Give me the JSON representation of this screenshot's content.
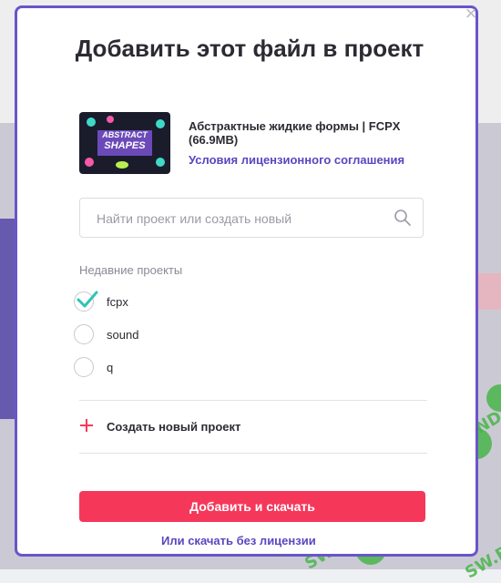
{
  "modal": {
    "title": "Добавить этот файл в проект",
    "file": {
      "thumbnail_text_line1": "ABSTRACT",
      "thumbnail_text_line2": "SHAPES",
      "name": "Абстрактные жидкие формы | FCPX (66.9MB)",
      "license_link": "Условия лицензионного соглашения"
    },
    "search": {
      "placeholder": "Найти проект или создать новый"
    },
    "recent_label": "Недавние проекты",
    "projects": [
      {
        "label": "fcpx",
        "checked": true
      },
      {
        "label": "sound",
        "checked": false
      },
      {
        "label": "q",
        "checked": false
      }
    ],
    "create_new_label": "Создать новый проект",
    "primary_button": "Добавить и скачать",
    "secondary_link": "Или скачать без лицензии"
  },
  "watermark": {
    "text": "SW.BAND"
  },
  "colors": {
    "accent_purple": "#5b45c0",
    "primary_red": "#f5385a",
    "check_teal": "#2ec4b6",
    "modal_border": "#6a55c9",
    "watermark_green": "#49b54a"
  }
}
